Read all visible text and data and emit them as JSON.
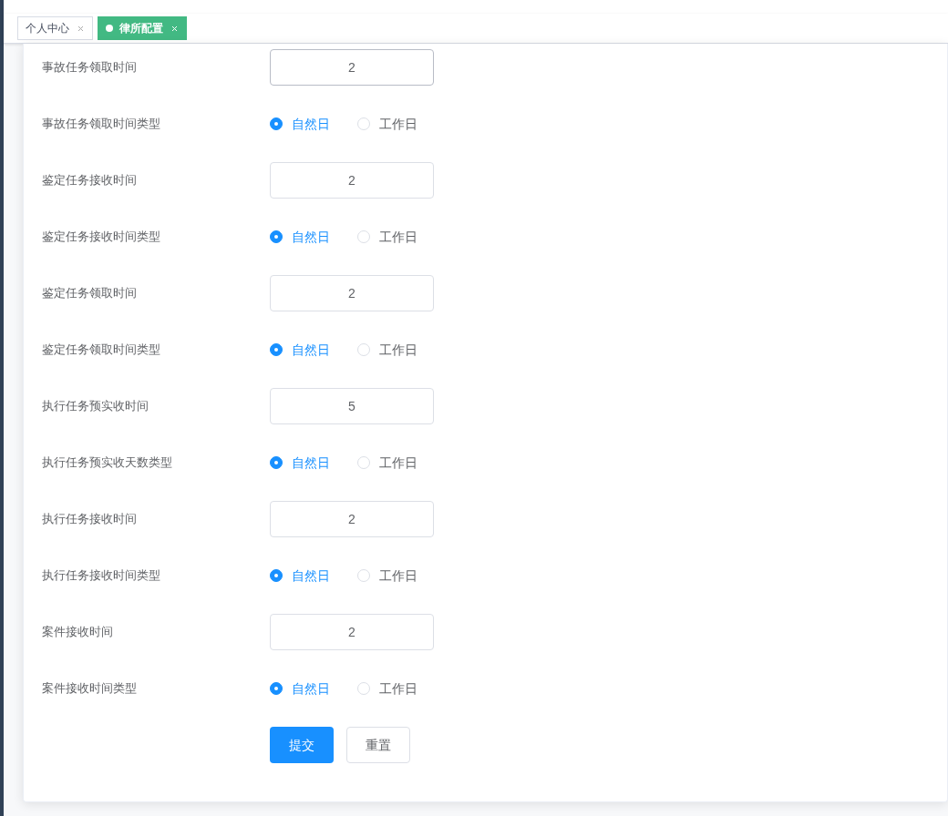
{
  "tags": [
    {
      "label": "个人中心",
      "selected": false
    },
    {
      "label": "律所配置",
      "selected": true
    }
  ],
  "fields": [
    {
      "kind": "number",
      "label": "事故任务领取时间",
      "value": "2",
      "hovered": true
    },
    {
      "kind": "radio",
      "label": "事故任务领取时间类型",
      "options": [
        {
          "label": "自然日",
          "selected": true
        },
        {
          "label": "工作日",
          "selected": false
        }
      ]
    },
    {
      "kind": "number",
      "label": "鉴定任务接收时间",
      "value": "2",
      "hovered": false
    },
    {
      "kind": "radio",
      "label": "鉴定任务接收时间类型",
      "options": [
        {
          "label": "自然日",
          "selected": true
        },
        {
          "label": "工作日",
          "selected": false
        }
      ]
    },
    {
      "kind": "number",
      "label": "鉴定任务领取时间",
      "value": "2",
      "hovered": false
    },
    {
      "kind": "radio",
      "label": "鉴定任务领取时间类型",
      "options": [
        {
          "label": "自然日",
          "selected": true
        },
        {
          "label": "工作日",
          "selected": false
        }
      ]
    },
    {
      "kind": "number",
      "label": "执行任务预实收时间",
      "value": "5",
      "hovered": false
    },
    {
      "kind": "radio",
      "label": "执行任务预实收天数类型",
      "options": [
        {
          "label": "自然日",
          "selected": true
        },
        {
          "label": "工作日",
          "selected": false
        }
      ]
    },
    {
      "kind": "number",
      "label": "执行任务接收时间",
      "value": "2",
      "hovered": false
    },
    {
      "kind": "radio",
      "label": "执行任务接收时间类型",
      "options": [
        {
          "label": "自然日",
          "selected": true
        },
        {
          "label": "工作日",
          "selected": false
        }
      ]
    },
    {
      "kind": "number",
      "label": "案件接收时间",
      "value": "2",
      "hovered": false
    },
    {
      "kind": "radio",
      "label": "案件接收时间类型",
      "options": [
        {
          "label": "自然日",
          "selected": true
        },
        {
          "label": "工作日",
          "selected": false
        }
      ]
    }
  ],
  "buttons": [
    {
      "label": "提交",
      "kind": "primary"
    },
    {
      "label": "重置",
      "kind": "default"
    }
  ]
}
